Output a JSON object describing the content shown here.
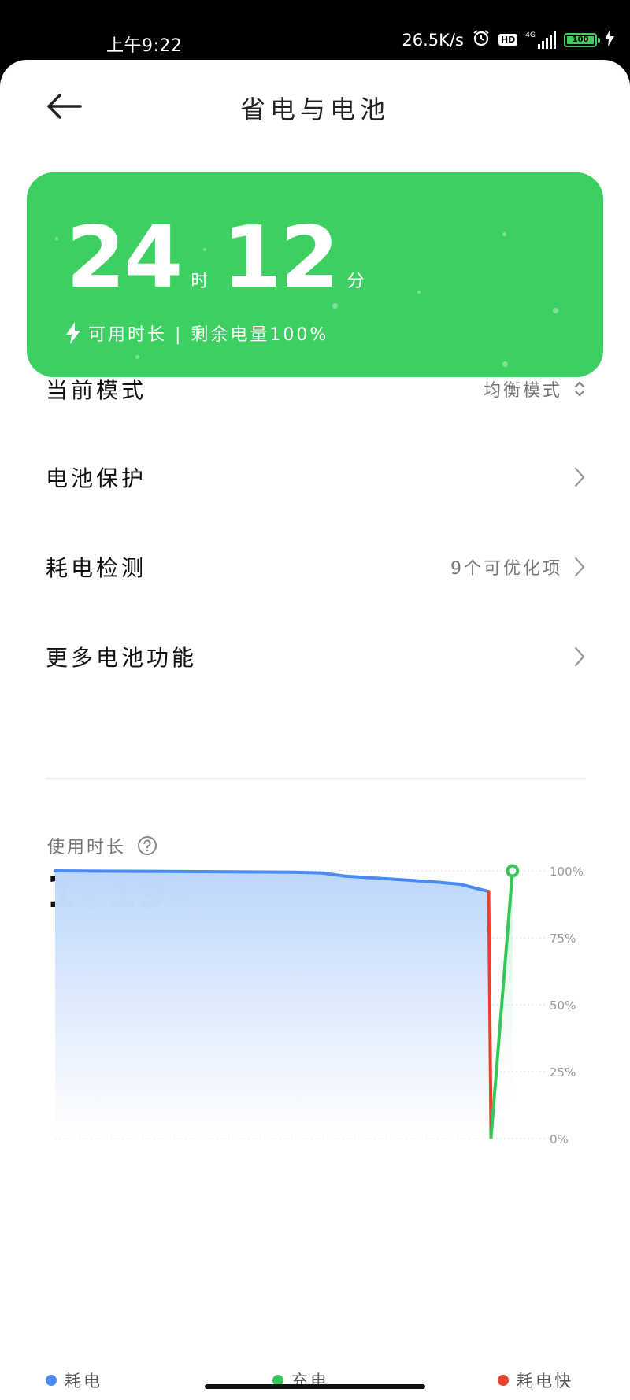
{
  "status_bar": {
    "time": "上午9:22",
    "net_speed": "26.5K/s",
    "hd_badge": "HD",
    "network": "4G",
    "battery_level": "100"
  },
  "header": {
    "title": "省电与电池"
  },
  "battery_card": {
    "hours": "24",
    "hours_unit": "时",
    "minutes": "12",
    "minutes_unit": "分",
    "subtitle": "可用时长 | 剩余电量100%",
    "bg_color": "#3ecf62"
  },
  "settings": {
    "mode_label": "当前模式",
    "mode_value": "均衡模式",
    "protection_label": "电池保护",
    "drain_label": "耗电检测",
    "drain_value": "9个可优化项",
    "more_label": "更多电池功能"
  },
  "usage": {
    "label": "使用时长",
    "hours": "1",
    "hours_unit": "时",
    "minutes": "19",
    "minutes_unit": "分"
  },
  "chart_data": {
    "type": "area",
    "y_ticks": [
      "100%",
      "75%",
      "50%",
      "25%",
      "0%"
    ],
    "ylim": [
      0,
      100
    ],
    "grid": true,
    "xlim": [
      0,
      100
    ],
    "series": [
      {
        "name": "耗电",
        "color": "#4a8af4",
        "x": [
          0,
          20,
          40,
          50,
          56,
          61,
          70,
          80,
          85,
          91
        ],
        "y": [
          100,
          99.8,
          99.6,
          99.5,
          99.2,
          98,
          97,
          95.8,
          95,
          92.3
        ]
      },
      {
        "name": "耗电快",
        "color": "#e8412c",
        "x": [
          91,
          91.5
        ],
        "y": [
          92.3,
          0.5
        ]
      },
      {
        "name": "充电",
        "color": "#34c759",
        "x": [
          91.5,
          96
        ],
        "y": [
          0.5,
          100
        ]
      }
    ],
    "legend_position": "bottom"
  }
}
